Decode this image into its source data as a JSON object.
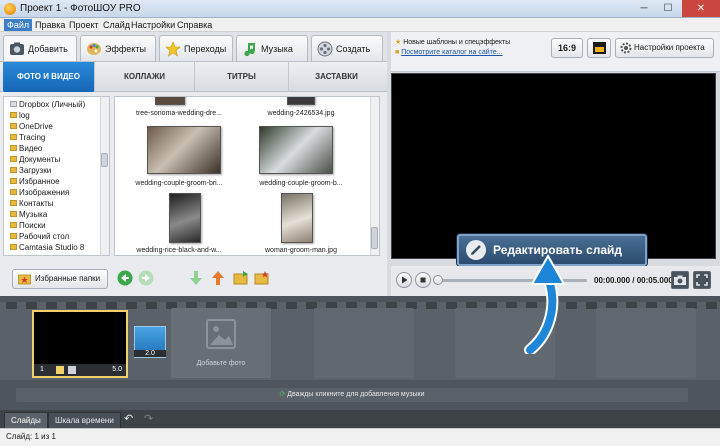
{
  "window": {
    "title": "Проект 1 - ФотоШОУ PRO",
    "minimize": "─",
    "maximize": "☐",
    "close": "✕"
  },
  "menu": [
    "Файл",
    "Правка",
    "Проект",
    "Слайд",
    "Настройки",
    "Справка"
  ],
  "main_tabs": [
    {
      "label": "Добавить",
      "icon": "add-icon"
    },
    {
      "label": "Эффекты",
      "icon": "palette-icon"
    },
    {
      "label": "Переходы",
      "icon": "star-icon"
    },
    {
      "label": "Музыка",
      "icon": "music-icon"
    },
    {
      "label": "Создать",
      "icon": "film-reel-icon"
    }
  ],
  "sub_tabs": [
    "ФОТО И ВИДЕО",
    "КОЛЛАЖИ",
    "ТИТРЫ",
    "ЗАСТАВКИ"
  ],
  "folders": [
    "Dropbox (Личный)",
    "log",
    "OneDrive",
    "Tracing",
    "Видео",
    "Документы",
    "Загрузки",
    "Избранное",
    "Изображения",
    "Контакты",
    "Музыка",
    "Поиски",
    "Рабочий стол",
    "Camtasia Studio 8"
  ],
  "files": [
    "tree-sonoma-wedding-dre...",
    "wedding-2426534.jpg",
    "wedding-couple-groom-bri...",
    "wedding-couple-groom-b...",
    "wedding-rice-black-and-w...",
    "woman-groom-man.jpg"
  ],
  "favorites_button": "Избранные папки",
  "news": {
    "line1": "Новые шаблоны и спецэффекты",
    "line2": "Посмотрите каталог на сайте..."
  },
  "aspect_ratio": "16:9",
  "project_settings": "Настройки проекта",
  "edit_slide_button": "Редактировать слайд",
  "player": {
    "time": "00:00.000 / 00:05.000"
  },
  "timeline": {
    "slide_number": "1",
    "slide_duration": "5.0",
    "transition_duration": "2.0",
    "add_photo": "Добавьте фото",
    "music_hint": "Дважды кликните для добавления музыки"
  },
  "bottom_tabs": [
    "Слайды",
    "Шкала времени"
  ],
  "status": "Слайд: 1 из 1",
  "colors": {
    "accent": "#1f78c8",
    "highlight_border": "#f0d06b",
    "arrow": "#1e86d8"
  }
}
